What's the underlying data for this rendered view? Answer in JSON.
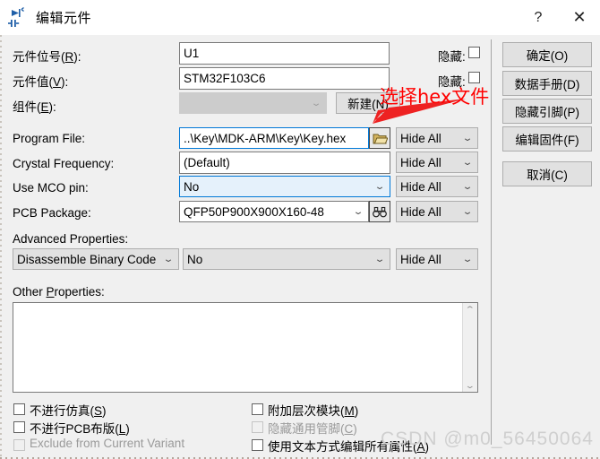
{
  "window": {
    "title": "编辑元件",
    "icon": "component-edit-icon",
    "help_label": "?",
    "close_label": "✕"
  },
  "fields": {
    "designator": {
      "label_pre": "元件位号(",
      "label_key": "R",
      "label_post": "):",
      "value": "U1",
      "hide_label_pre": "隐藏",
      "hide_label_post": ":"
    },
    "value": {
      "label_pre": "元件值(",
      "label_key": "V",
      "label_post": "):",
      "value": "STM32F103C6",
      "hide_label_pre": "隐藏",
      "hide_label_post": ":"
    },
    "element": {
      "label_pre": "组件(",
      "label_key": "E",
      "label_post": "):",
      "value": "",
      "new_button": "新建(N)"
    },
    "program_file": {
      "label": "Program File:",
      "value": "..\\Key\\MDK-ARM\\Key\\Key.hex",
      "browse_icon": "folder-open-icon",
      "hide_value": "Hide All"
    },
    "crystal_frequency": {
      "label": "Crystal Frequency:",
      "value": "(Default)",
      "hide_value": "Hide All"
    },
    "use_mco_pin": {
      "label": "Use MCO pin:",
      "value": "No",
      "hide_value": "Hide All"
    },
    "pcb_package": {
      "label": "PCB Package:",
      "value": "QFP50P900X900X160-48",
      "search_icon": "binoculars-icon",
      "hide_value": "Hide All"
    },
    "advanced_properties": {
      "label": "Advanced Properties:",
      "property_value": "Disassemble Binary Code",
      "setting_value": "No",
      "hide_value": "Hide All"
    },
    "other_properties": {
      "label_pre": "Other ",
      "label_key": "P",
      "label_post": "roperties:",
      "value": "",
      "scroll_up": "⌃",
      "scroll_down": "⌄"
    }
  },
  "buttons": {
    "ok": "确定(O)",
    "datasheet": "数据手册(D)",
    "hide_pins": "隐藏引脚(P)",
    "edit_firmware": "编辑固件(F)",
    "cancel": "取消(C)"
  },
  "checkboxes": {
    "no_simulation": {
      "label_pre": "不进行仿真(",
      "label_key": "S",
      "label_post": ")",
      "checked": false,
      "disabled": false
    },
    "no_pcb_layout": {
      "label_pre": "不进行PCB布版(",
      "label_key": "L",
      "label_post": ")",
      "checked": false,
      "disabled": false
    },
    "exclude_variant": {
      "label_pre": "Exclude from Current Variant",
      "label_key": "",
      "label_post": "",
      "checked": false,
      "disabled": true
    },
    "attach_hierarchy": {
      "label_pre": "附加层次模块(",
      "label_key": "M",
      "label_post": ")",
      "checked": false,
      "disabled": false
    },
    "hide_common_pins": {
      "label_pre": "隐藏通用管脚(",
      "label_key": "C",
      "label_post": ")",
      "checked": false,
      "disabled": true
    },
    "edit_all_as_text": {
      "label_pre": "使用文本方式编辑所有属性(",
      "label_key": "A",
      "label_post": ")",
      "checked": false,
      "disabled": false
    }
  },
  "annotation": {
    "text": "选择hex文件",
    "color": "#ff0000",
    "arrow": "red-arrow-pointing-to-browse-button"
  },
  "watermark": {
    "text": "CSDN @m0_56450064",
    "color": "#cfcfcf"
  }
}
